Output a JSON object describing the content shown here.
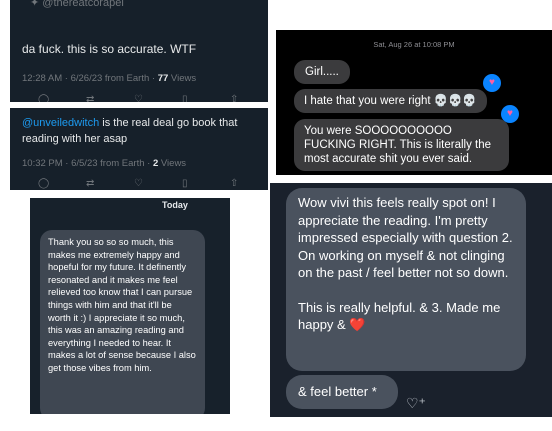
{
  "tweet1": {
    "handle": "@thereatcorapel",
    "text": "da fuck. this is so accurate. WTF",
    "time": "12:28 AM · 6/26/23 from Earth · ",
    "views_count": "77",
    "views_label": " Views"
  },
  "tweet2": {
    "mention": "@unveiledwitch",
    "text": " is the real deal go book that reading with her asap",
    "time": "10:32 PM · 6/5/23 from Earth · ",
    "views_count": "2",
    "views_label": " Views"
  },
  "imessage": {
    "date": "Sat, Aug 26 at 10:08 PM",
    "messages": [
      "Girl.....",
      "I hate that you were right 💀💀💀",
      "You were SOOOOOOOOOO FUCKING RIGHT. This is literally the most accurate shit you ever said."
    ]
  },
  "chat1": {
    "day_label": "Today",
    "message": "Thank you so so so much, this makes me extremely happy and hopeful for my future. It definently resonated and it makes me feel relieved too know that I can pursue things with him and that it'll be worth it :) I appreciate it so much, this was an amazing reading and everything I needed to hear. It makes a lot of sense because I also get those vibes from him."
  },
  "chat2": {
    "message_p1": "Wow vivi this feels really spot on! I appreciate the reading. I'm pretty impressed especially with question 2. On working on myself & not clinging on the past / feel better not so down.",
    "message_p2": "This is really helpful. & 3. Made me happy & ❤️",
    "message_2": "& feel better *"
  },
  "colors": {
    "tweet_bg": "#16202a",
    "twitter_blue": "#1d9bf0",
    "imessage_bg": "#000000",
    "imessage_bubble": "#3b3b3d",
    "chat_bubble": "#4a525e"
  },
  "icons": [
    "reply-icon",
    "retweet-icon",
    "like-icon",
    "bookmark-icon",
    "share-icon",
    "heart-reaction-icon",
    "add-reaction-icon"
  ]
}
